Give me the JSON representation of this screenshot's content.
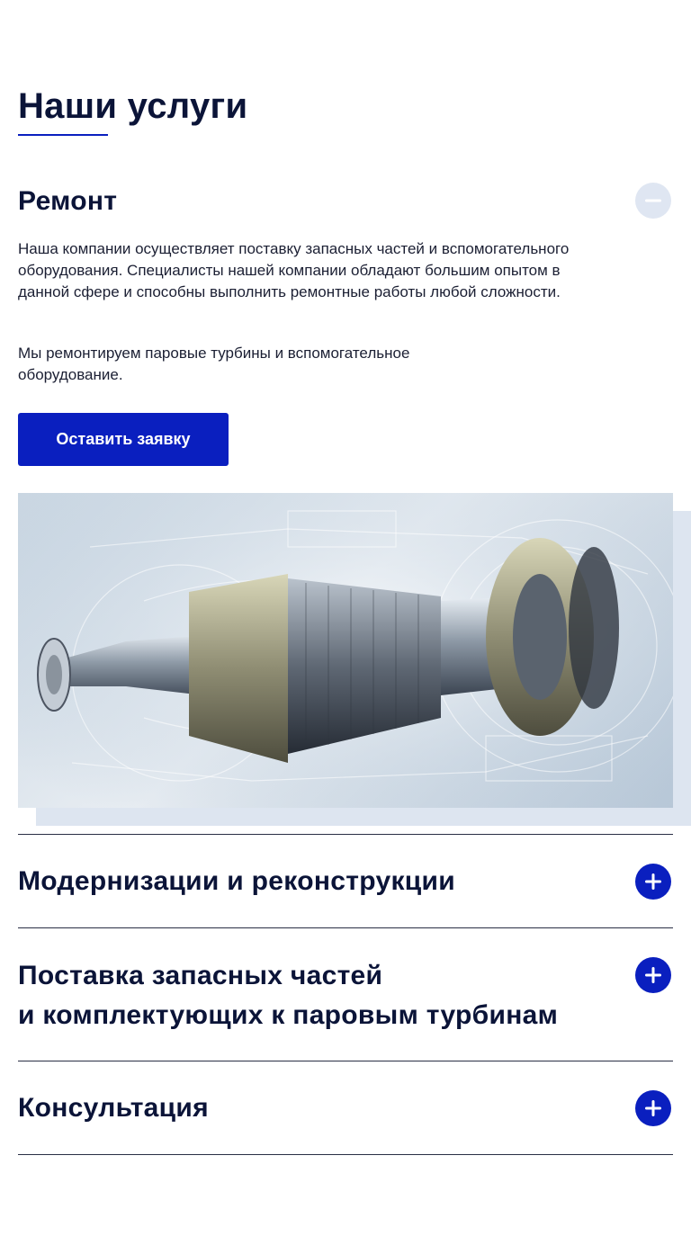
{
  "page": {
    "title": "Наши услуги"
  },
  "services": [
    {
      "title": "Ремонт",
      "expanded": true,
      "paragraphs": [
        "Наша компании осуществляет поставку запасных частей и вспомогательного оборудования. Специалисты нашей компании обладают большим опытом в данной сфере и способны выполнить ремонтные работы любой сложности.",
        "Мы ремонтируем паровые турбины и вспомогательное оборудование."
      ],
      "button_label": "Оставить заявку",
      "toggle_icon": "minus-icon"
    },
    {
      "title": "Модернизации и реконструкции",
      "expanded": false,
      "toggle_icon": "plus-icon"
    },
    {
      "title_line1": "Поставка запасных частей",
      "title_line2": "и комплектующих к паровым турбинам",
      "expanded": false,
      "toggle_icon": "plus-icon"
    },
    {
      "title": "Консультация",
      "expanded": false,
      "toggle_icon": "plus-icon"
    }
  ],
  "colors": {
    "accent": "#0a1fbf",
    "heading": "#0b1438",
    "toggle_expanded_bg": "#dfe6f2"
  }
}
